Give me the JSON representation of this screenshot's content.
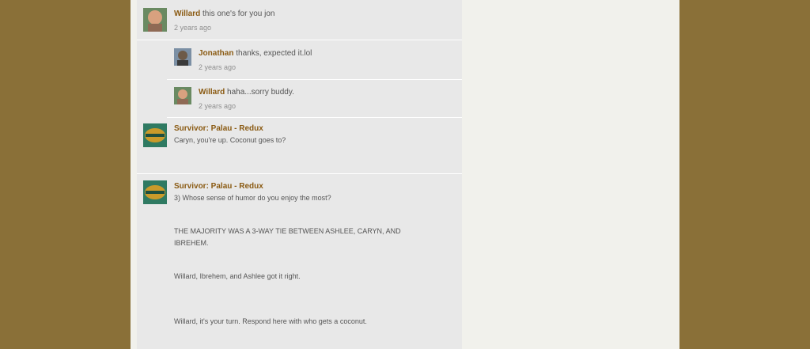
{
  "comments": [
    {
      "author": "Willard",
      "message": "this one's for you jon",
      "time": "2 years ago"
    },
    {
      "author": "Jonathan",
      "message": "thanks, expected it.lol",
      "time": "2 years ago"
    },
    {
      "author": "Willard",
      "message": "haha...sorry buddy.",
      "time": "2 years ago"
    },
    {
      "author": "Survivor: Palau - Redux",
      "message": "Caryn, you're up.  Coconut goes to?"
    },
    {
      "author": "Survivor: Palau - Redux",
      "lines": [
        "3)  Whose sense of humor do you enjoy the most?",
        "THE MAJORITY WAS A 3-WAY TIE BETWEEN ASHLEE, CARYN, AND",
        "IBREHEM.",
        "Willard, Ibrehem, and Ashlee got it right.",
        "Willard, it's your turn.  Respond here with who gets a coconut."
      ]
    }
  ],
  "colors": {
    "author": "#8a5a12",
    "meta": "#8f8f8f",
    "text": "#555555",
    "frame": "#8a7038"
  }
}
